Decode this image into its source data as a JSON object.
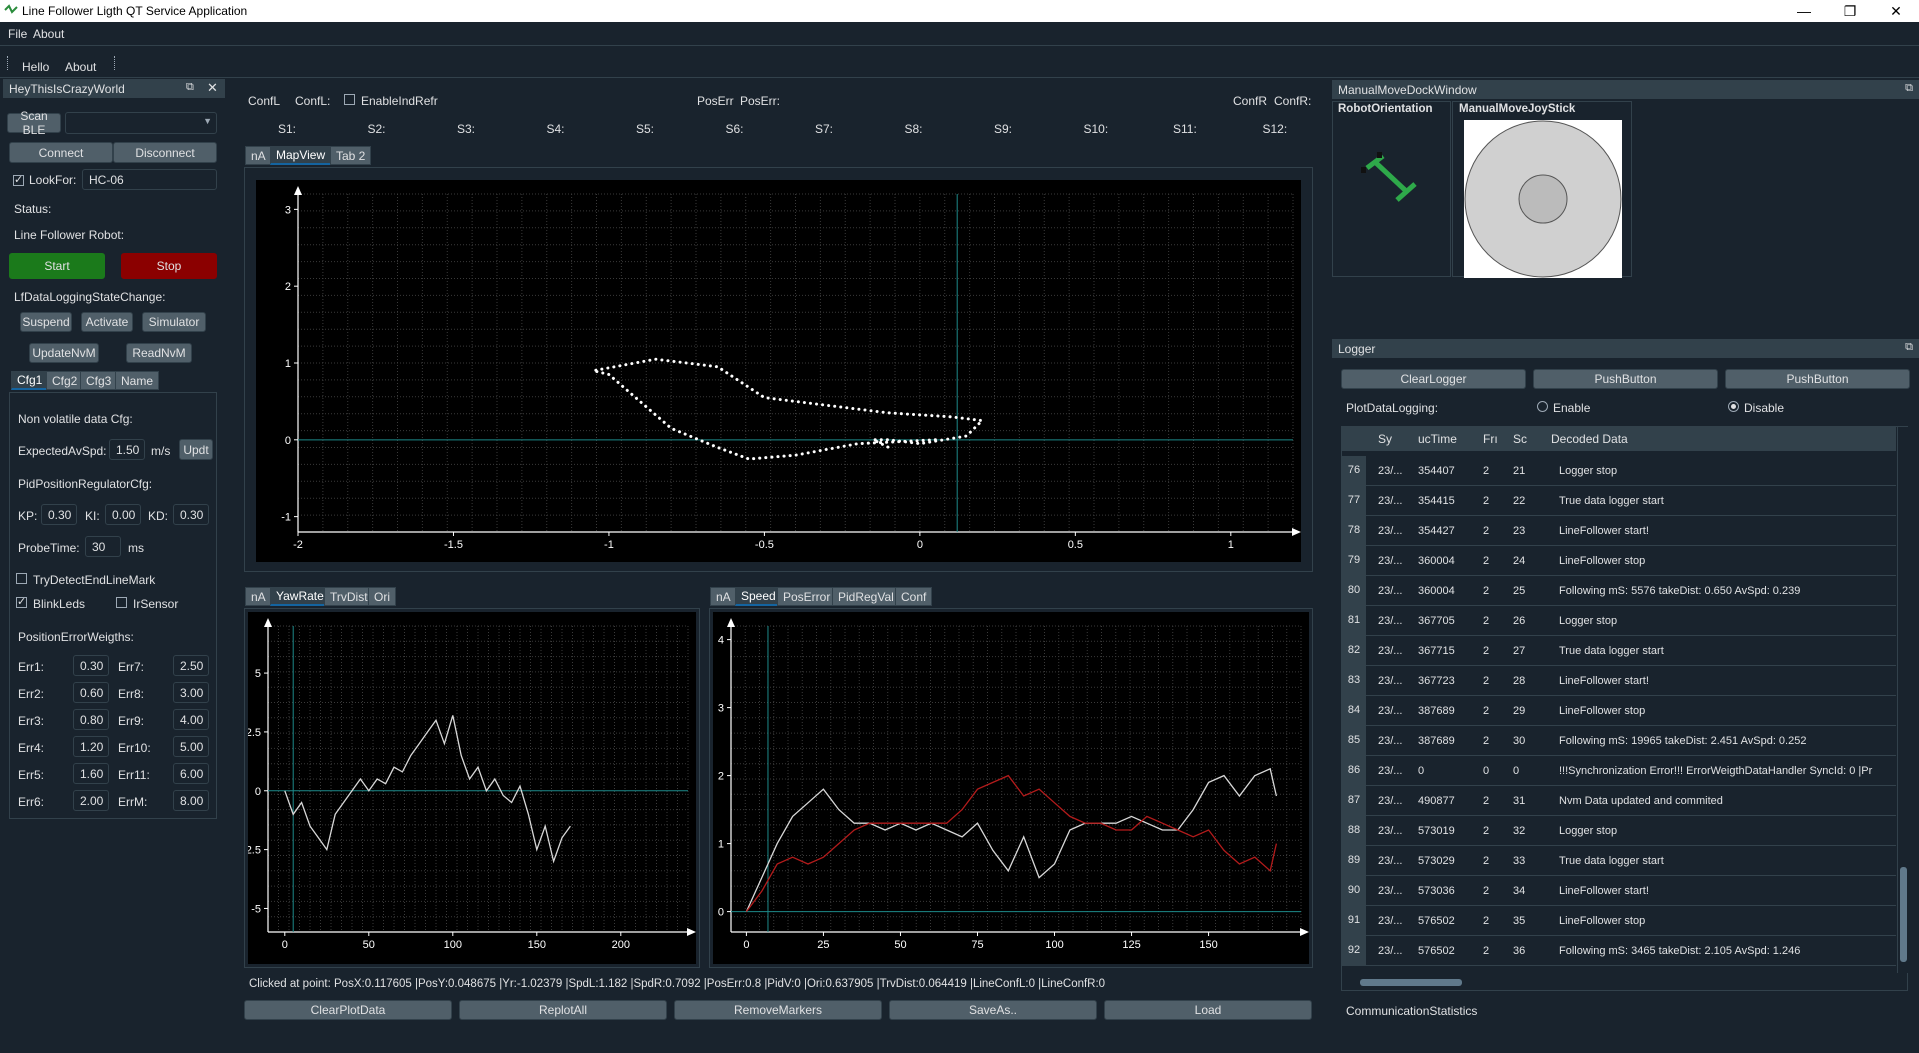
{
  "window": {
    "title": "Line Follower Ligth QT Service Application",
    "min": "—",
    "max": "❐",
    "close": "✕"
  },
  "menu": {
    "file": "File",
    "about": "About"
  },
  "toolbar": {
    "hello": "Hello",
    "about": "About"
  },
  "left_dock": {
    "title": "HeyThisIsCrazyWorld",
    "scan_ble": "Scan BLE",
    "connect": "Connect",
    "disconnect": "Disconnect",
    "lookfor_label": "LookFor:",
    "lookfor_value": "HC-06",
    "status_label": "Status:",
    "robot_label": "Line Follower Robot:",
    "start": "Start",
    "stop": "Stop",
    "logging_label": "LfDataLoggingStateChange:",
    "suspend": "Suspend",
    "activate": "Activate",
    "simulator": "Simulator",
    "update_nvm": "UpdateNvM",
    "read_nvm": "ReadNvM",
    "tabs": [
      "Cfg1",
      "Cfg2",
      "Cfg3",
      "Name"
    ],
    "nv_label": "Non volatile data Cfg:",
    "exp_spd_label": "ExpectedAvSpd:",
    "exp_spd_value": "1.50",
    "exp_spd_unit": "m/s",
    "updt": "Updt",
    "pid_label": "PidPositionRegulatorCfg:",
    "kp_label": "KP:",
    "kp_value": "0.30",
    "ki_label": "KI:",
    "ki_value": "0.00",
    "kd_label": "KD:",
    "kd_value": "0.30",
    "probe_label": "ProbeTime:",
    "probe_value": "30",
    "probe_unit": "ms",
    "try_detect": "TryDetectEndLineMark",
    "blink": "BlinkLeds",
    "irsensor": "IrSensor",
    "weights_label": "PositionErrorWeigths:",
    "weights": [
      {
        "l": "Err1:",
        "v": "0.30",
        "l2": "Err7:",
        "v2": "2.50"
      },
      {
        "l": "Err2:",
        "v": "0.60",
        "l2": "Err8:",
        "v2": "3.00"
      },
      {
        "l": "Err3:",
        "v": "0.80",
        "l2": "Err9:",
        "v2": "4.00"
      },
      {
        "l": "Err4:",
        "v": "1.20",
        "l2": "Err10:",
        "v2": "5.00"
      },
      {
        "l": "Err5:",
        "v": "1.60",
        "l2": "Err11:",
        "v2": "6.00"
      },
      {
        "l": "Err6:",
        "v": "2.00",
        "l2": "ErrM:",
        "v2": "8.00"
      }
    ]
  },
  "center": {
    "conf_labels": [
      "ConfL",
      "ConfL:"
    ],
    "enable_ind": "EnableIndRefr",
    "poserr_labels": [
      "PosErr",
      "PosErr:"
    ],
    "confr_labels": [
      "ConfR",
      "ConfR:"
    ],
    "sensors": [
      "S1:",
      "S2:",
      "S3:",
      "S4:",
      "S5:",
      "S6:",
      "S7:",
      "S8:",
      "S9:",
      "S10:",
      "S11:",
      "S12:"
    ],
    "top_tabs": [
      "nA",
      "MapView",
      "Tab 2"
    ],
    "left_tabs": [
      "nA",
      "YawRate",
      "TrvDist",
      "Ori"
    ],
    "right_tabs": [
      "nA",
      "Speed",
      "PosError",
      "PidRegVal",
      "Conf"
    ],
    "status_line": "Clicked at point: PosX:0.117605 |PosY:0.048675 |Yr:-1.02379 |SpdL:1.182 |SpdR:0.7092 |PosErr:0.8 |PidV:0 |Ori:0.637905 |TrvDist:0.064419 |LineConfL:0 |LineConfR:0",
    "buttons": [
      "ClearPlotData",
      "ReplotAll",
      "RemoveMarkers",
      "SaveAs..",
      "Load"
    ]
  },
  "chart_data": [
    {
      "type": "line",
      "name": "map-view",
      "xlim": [
        -2,
        1.2
      ],
      "ylim": [
        -1.2,
        3.2
      ],
      "xticks": [
        "-2",
        "-1.5",
        "-1",
        "-0.5",
        "0",
        "0.5",
        "1"
      ],
      "yticks": [
        "-1",
        "0",
        "1",
        "2",
        "3"
      ],
      "grid": true,
      "series": [
        {
          "style": "dotted-white",
          "x": [
            0.05,
            -0.2,
            -0.4,
            -0.55,
            -0.65,
            -0.8,
            -1.0,
            -1.05,
            -0.85,
            -0.65,
            -0.5,
            -0.3,
            -0.1,
            0.1,
            0.2,
            0.15,
            0.0,
            -0.1,
            -0.15,
            -0.1
          ],
          "y": [
            0.0,
            -0.05,
            -0.2,
            -0.25,
            -0.1,
            0.15,
            0.85,
            0.9,
            1.05,
            0.95,
            0.55,
            0.45,
            0.35,
            0.3,
            0.25,
            0.05,
            -0.05,
            0.0,
            0.0,
            -0.1
          ]
        }
      ]
    },
    {
      "type": "line",
      "name": "yaw-rate",
      "xlim": [
        -10,
        240
      ],
      "ylim": [
        -6,
        7
      ],
      "xticks": [
        "0",
        "50",
        "100",
        "150",
        "200"
      ],
      "yticks": [
        "-5",
        "-2.5",
        "0",
        "2.5",
        "5"
      ],
      "grid": true,
      "series": [
        {
          "style": "white",
          "x": [
            0,
            5,
            10,
            15,
            20,
            25,
            30,
            35,
            40,
            45,
            50,
            55,
            60,
            65,
            70,
            75,
            80,
            85,
            90,
            95,
            100,
            105,
            110,
            115,
            120,
            125,
            130,
            135,
            140,
            145,
            150,
            155,
            160,
            165,
            170
          ],
          "y": [
            0,
            -1,
            -0.5,
            -1.5,
            -2,
            -2.5,
            -1,
            -0.5,
            0,
            0.5,
            0,
            0.5,
            0.3,
            1,
            0.8,
            1.5,
            2,
            2.5,
            3,
            2,
            3.2,
            1.5,
            0.5,
            1,
            0,
            0.5,
            -0.2,
            -0.5,
            0.2,
            -1,
            -2.5,
            -1.5,
            -3,
            -2,
            -1.5
          ]
        }
      ]
    },
    {
      "type": "line",
      "name": "speed",
      "xlim": [
        -5,
        180
      ],
      "ylim": [
        -0.3,
        4.2
      ],
      "xticks": [
        "0",
        "25",
        "50",
        "75",
        "100",
        "125",
        "150"
      ],
      "yticks": [
        "0",
        "1",
        "2",
        "3",
        "4"
      ],
      "grid": true,
      "series": [
        {
          "style": "white",
          "x": [
            0,
            5,
            10,
            15,
            20,
            25,
            30,
            35,
            40,
            45,
            50,
            55,
            60,
            65,
            70,
            75,
            80,
            85,
            90,
            95,
            100,
            105,
            110,
            115,
            120,
            125,
            130,
            135,
            140,
            145,
            150,
            155,
            160,
            165,
            170,
            172
          ],
          "y": [
            0,
            0.5,
            1,
            1.4,
            1.6,
            1.8,
            1.5,
            1.3,
            1.3,
            1.2,
            1.3,
            1.2,
            1.3,
            1.2,
            1.1,
            1.3,
            0.9,
            0.6,
            1.1,
            0.5,
            0.7,
            1.2,
            1.3,
            1.3,
            1.3,
            1.4,
            1.3,
            1.2,
            1.2,
            1.5,
            1.9,
            2.0,
            1.7,
            2.0,
            2.1,
            1.7
          ]
        },
        {
          "style": "red",
          "x": [
            0,
            5,
            10,
            15,
            20,
            25,
            30,
            35,
            40,
            45,
            50,
            55,
            60,
            65,
            70,
            75,
            80,
            85,
            90,
            95,
            100,
            105,
            110,
            115,
            120,
            125,
            130,
            135,
            140,
            145,
            150,
            155,
            160,
            165,
            170,
            172
          ],
          "y": [
            0,
            0.3,
            0.7,
            0.8,
            0.7,
            0.8,
            1.0,
            1.2,
            1.3,
            1.3,
            1.3,
            1.3,
            1.3,
            1.3,
            1.5,
            1.8,
            1.9,
            2.0,
            1.7,
            1.8,
            1.6,
            1.4,
            1.3,
            1.3,
            1.2,
            1.2,
            1.4,
            1.3,
            1.2,
            1.1,
            1.2,
            0.9,
            0.7,
            0.8,
            0.6,
            1.0
          ]
        }
      ]
    }
  ],
  "right": {
    "manual_title": "ManualMoveDockWindow",
    "orientation_label": "RobotOrientation",
    "joystick_label": "ManualMoveJoyStick",
    "logger_title": "Logger",
    "clear_logger": "ClearLogger",
    "push1": "PushButton",
    "push2": "PushButton",
    "plot_logging": "PlotDataLogging:",
    "enable": "Enable",
    "disable": "Disable",
    "headers": [
      "Sy",
      "ucTime",
      "Frı",
      "Sc",
      "Decoded Data"
    ],
    "rows": [
      {
        "n": "76",
        "sy": "23/...",
        "t": "354407",
        "f": "2",
        "sc": "21",
        "d": "Logger stop"
      },
      {
        "n": "77",
        "sy": "23/...",
        "t": "354415",
        "f": "2",
        "sc": "22",
        "d": "True data logger start"
      },
      {
        "n": "78",
        "sy": "23/...",
        "t": "354427",
        "f": "2",
        "sc": "23",
        "d": "LineFollower start!"
      },
      {
        "n": "79",
        "sy": "23/...",
        "t": "360004",
        "f": "2",
        "sc": "24",
        "d": "LineFollower stop"
      },
      {
        "n": "80",
        "sy": "23/...",
        "t": "360004",
        "f": "2",
        "sc": "25",
        "d": "Following mS: 5576 takeDist: 0.650 AvSpd: 0.239"
      },
      {
        "n": "81",
        "sy": "23/...",
        "t": "367705",
        "f": "2",
        "sc": "26",
        "d": "Logger stop"
      },
      {
        "n": "82",
        "sy": "23/...",
        "t": "367715",
        "f": "2",
        "sc": "27",
        "d": "True data logger start"
      },
      {
        "n": "83",
        "sy": "23/...",
        "t": "367723",
        "f": "2",
        "sc": "28",
        "d": "LineFollower start!"
      },
      {
        "n": "84",
        "sy": "23/...",
        "t": "387689",
        "f": "2",
        "sc": "29",
        "d": "LineFollower stop"
      },
      {
        "n": "85",
        "sy": "23/...",
        "t": "387689",
        "f": "2",
        "sc": "30",
        "d": "Following mS: 19965 takeDist: 2.451 AvSpd: 0.252"
      },
      {
        "n": "86",
        "sy": "23/...",
        "t": "0",
        "f": "0",
        "sc": "0",
        "d": "!!!Synchronization Error!!! ErrorWeigthDataHandler SyncId: 0 |Pr"
      },
      {
        "n": "87",
        "sy": "23/...",
        "t": "490877",
        "f": "2",
        "sc": "31",
        "d": "Nvm Data updated and commited"
      },
      {
        "n": "88",
        "sy": "23/...",
        "t": "573019",
        "f": "2",
        "sc": "32",
        "d": "Logger stop"
      },
      {
        "n": "89",
        "sy": "23/...",
        "t": "573029",
        "f": "2",
        "sc": "33",
        "d": "True data logger start"
      },
      {
        "n": "90",
        "sy": "23/...",
        "t": "573036",
        "f": "2",
        "sc": "34",
        "d": "LineFollower start!"
      },
      {
        "n": "91",
        "sy": "23/...",
        "t": "576502",
        "f": "2",
        "sc": "35",
        "d": "LineFollower stop"
      },
      {
        "n": "92",
        "sy": "23/...",
        "t": "576502",
        "f": "2",
        "sc": "36",
        "d": "Following mS: 3465 takeDist: 2.105 AvSpd: 1.246"
      }
    ],
    "comm_stats": "CommunicationStatistics"
  },
  "colors": {
    "bg": "#19232d",
    "panel": "#32414b",
    "button": "#505f69",
    "start": "#1b7a1b",
    "stop": "#8b0000",
    "accent": "#1464a0"
  }
}
